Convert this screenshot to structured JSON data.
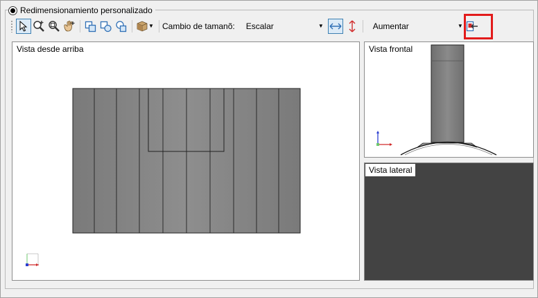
{
  "group": {
    "label": "Redimensionamiento personalizado"
  },
  "toolbar": {
    "tools": [
      {
        "name": "select-pointer-icon"
      },
      {
        "name": "zoom-in-icon"
      },
      {
        "name": "zoom-fit-icon"
      },
      {
        "name": "pan-hand-icon"
      },
      {
        "name": "shape-view-1-icon"
      },
      {
        "name": "shape-view-2-icon"
      },
      {
        "name": "shape-view-3-icon"
      },
      {
        "name": "box-3d-icon"
      }
    ],
    "resize_label": "Cambio de tamanõ:",
    "resize_mode": "Escalar",
    "horizontal_icon": "horizontal-arrows-icon",
    "vertical_icon": "vertical-arrows-icon",
    "direction_label": "Aumentar",
    "export_icon": "insert-export-icon"
  },
  "views": {
    "top": {
      "title": "Vista desde arriba"
    },
    "front": {
      "title": "Vista frontal"
    },
    "side": {
      "title": "Vista lateral"
    }
  },
  "colors": {
    "highlight": "#e21b1b",
    "accent": "#3c7fb1",
    "side_view_bg": "#434343",
    "part_fill": "#808080"
  }
}
